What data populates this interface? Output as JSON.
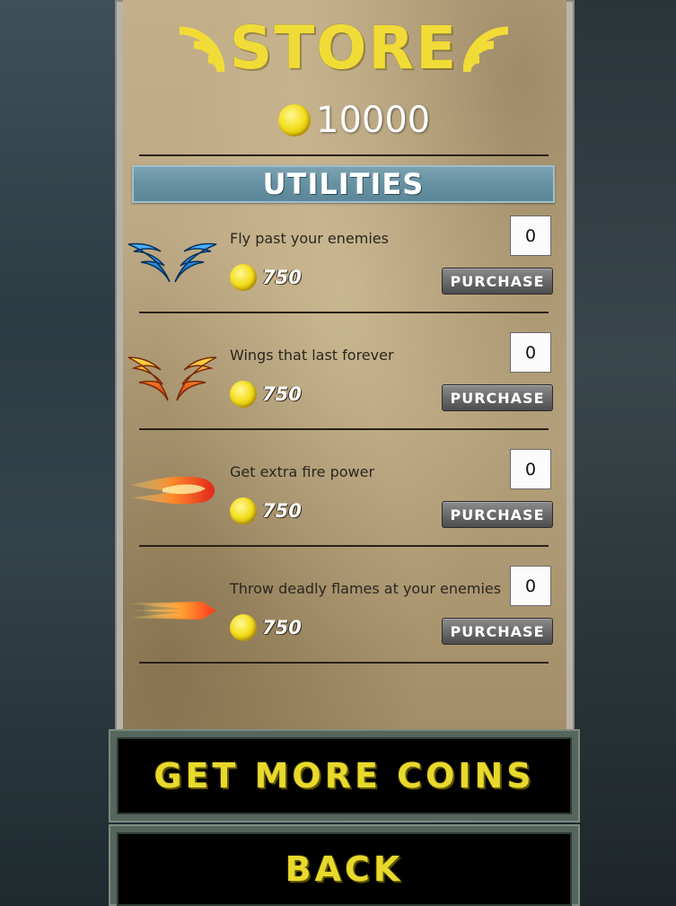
{
  "store": {
    "title": "STORE",
    "balance": "10000",
    "section_title": "UTILITIES"
  },
  "items": [
    {
      "icon": "blue-wings-icon",
      "description": "Fly past your enemies",
      "price": "750",
      "quantity": "0",
      "button": "PURCHASE"
    },
    {
      "icon": "fire-wings-icon",
      "description": "Wings that last forever",
      "price": "750",
      "quantity": "0",
      "button": "PURCHASE"
    },
    {
      "icon": "fireball-icon",
      "description": "Get extra fire power",
      "price": "750",
      "quantity": "0",
      "button": "PURCHASE"
    },
    {
      "icon": "flame-streak-icon",
      "description": "Throw deadly flames at your enemies",
      "price": "750",
      "quantity": "0",
      "button": "PURCHASE"
    }
  ],
  "buttons": {
    "get_more_coins": "GET MORE COINS",
    "back": "BACK"
  },
  "colors": {
    "title_yellow": "#f1dc37",
    "section_bar": "#6691a2",
    "coin_gold": "#f4e021",
    "button_frame": "#55665c"
  }
}
